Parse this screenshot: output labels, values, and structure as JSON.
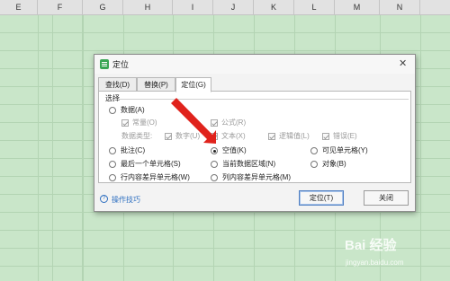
{
  "columns": [
    "E",
    "F",
    "G",
    "H",
    "I",
    "J",
    "K",
    "L",
    "M",
    "N"
  ],
  "dialog": {
    "title": "定位",
    "close": "✕",
    "tabs": [
      "查找(D)",
      "替换(P)",
      "定位(G)"
    ],
    "group_label": "选择",
    "options": {
      "data": "数据(A)",
      "constant": "常量(O)",
      "formula": "公式(R)",
      "data_type_label": "数据类型:",
      "number": "数字(U)",
      "text": "文本(X)",
      "logical": "逻辑值(L)",
      "error": "错误(E)",
      "comment": "批注(C)",
      "blank": "空值(K)",
      "visible_cells": "可见单元格(Y)",
      "last_cell": "最后一个单元格(S)",
      "current_region": "当前数据区域(N)",
      "objects": "对象(B)",
      "row_diff": "行内容差异单元格(W)",
      "col_diff": "列内容差异单元格(M)"
    },
    "tips_label": "操作技巧",
    "locate_button": "定位(T)",
    "close_button": "关闭"
  },
  "watermark": {
    "main": "Bai 经验",
    "sub": "jingyan.baidu.com"
  }
}
